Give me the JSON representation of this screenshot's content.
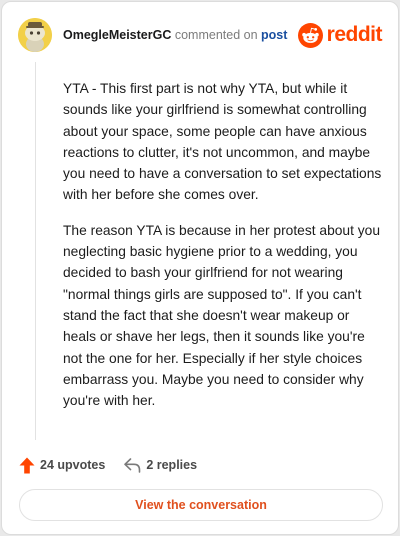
{
  "comment": {
    "author": "OmegleMeisterGC",
    "verb": "commented on",
    "target": "post",
    "paragraphs": [
      "YTA - This first part is not why YTA, but while it sounds like your girlfriend is somewhat controlling about your space, some people can have anxious reactions to clutter, it's not uncommon, and maybe you need to have a conversation to set expectations with her before she comes over.",
      "The reason YTA is because in her protest about you neglecting basic hygiene prior to a wedding, you decided to bash your girlfriend for not wearing \"normal things girls are supposed to\". If you can't stand the fact that she doesn't wear makeup or heals or shave her legs, then it sounds like you're not the one for her. Especially if her style choices embarrass you. Maybe you need to consider why you're with her."
    ]
  },
  "brand": {
    "wordmark": "reddit",
    "color": "#ff4500"
  },
  "stats": {
    "upvotes": "24 upvotes",
    "replies": "2 replies"
  },
  "cta": {
    "label": "View the conversation"
  },
  "colors": {
    "accent": "#ff4500",
    "link": "#1a4fa0",
    "cta_text": "#e0501e"
  }
}
